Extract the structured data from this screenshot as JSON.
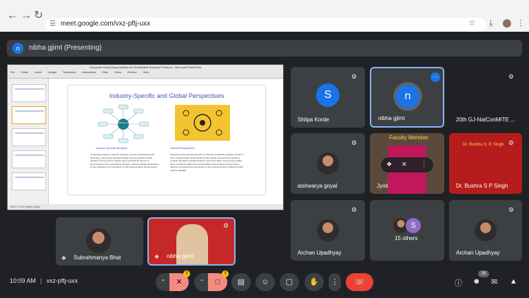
{
  "browser": {
    "url": "meet.google.com/vxz-pftj-uxx",
    "back_icon": "arrow-back-icon",
    "forward_icon": "arrow-forward-icon",
    "reload_icon": "reload-icon"
  },
  "presenting_bar": {
    "avatar_letter": "n",
    "label": "nibha gjimt (Presenting)"
  },
  "presentation": {
    "window_title": "Corporate Social Responsibility and Sustainable Business Practices  -  Microsoft PowerPoint",
    "tabs": "File Home Insert Design Transitions Animations Slide Show Review View",
    "slide_title": "Industry-Specific and Global Perspectives",
    "csr_center": "CSR Drivers",
    "left_subtitle": "Industry-Specific Analysis",
    "right_subtitle": "Global Perspectives",
    "left_text": "Conducting analysis on specific industries, such as manufacturing and technology, can provide important insights into the practices of CSR activities in those sectors. Studies have examined the classes of greenwashing in the manufactured products, offering valuable perspectives on the challenges and motivations of CSR implementation across sectors.",
    "right_text": "Examining cross-national research on CSR and sustainable practices provides a more comprehensive understanding of the cultural, economic and regulatory contexts that affect corporate behavior and trends. Major cross-country studies have revealed the difference in sustainability implementation across nations, offering a comprehensive examination of the contextual factors influencing CSR practices globally.",
    "status": "Slide 7 of 12   English (India)"
  },
  "tiles": [
    {
      "name": "Shilpa Korde",
      "letter": "S",
      "color": "#1a73e8"
    },
    {
      "name": "nibha gjimt",
      "letter": "n",
      "color": "#1a73e8"
    },
    {
      "name": "20th GJ-NatConMITE ..."
    },
    {
      "name": "aishwarya goyal"
    },
    {
      "name": "Jyoti"
    },
    {
      "name": "Dr. Bushra S P Singh"
    },
    {
      "name": "Archan Upadhyay"
    },
    {
      "name": "15 others",
      "letter": "S",
      "color": "#8e6cc4"
    },
    {
      "name": "Archan Upadhyay"
    },
    {
      "name": "Subrahmanya Bhat"
    },
    {
      "name": "nibha gjimt"
    }
  ],
  "tile_text": {
    "faculty_member": "Faculty Member",
    "bushra_banner": "Dr. Bushra S. P. Singh"
  },
  "toolbar": {
    "time": "10:09 AM",
    "separator": "|",
    "meeting_code": "vxz-pftj-uxx",
    "people_count": "26",
    "warn_badge": "!"
  },
  "colors": {
    "accent": "#1a73e8",
    "end_call": "#ea4335",
    "warning": "#fbbc04",
    "tile_bg": "#3c4043"
  }
}
